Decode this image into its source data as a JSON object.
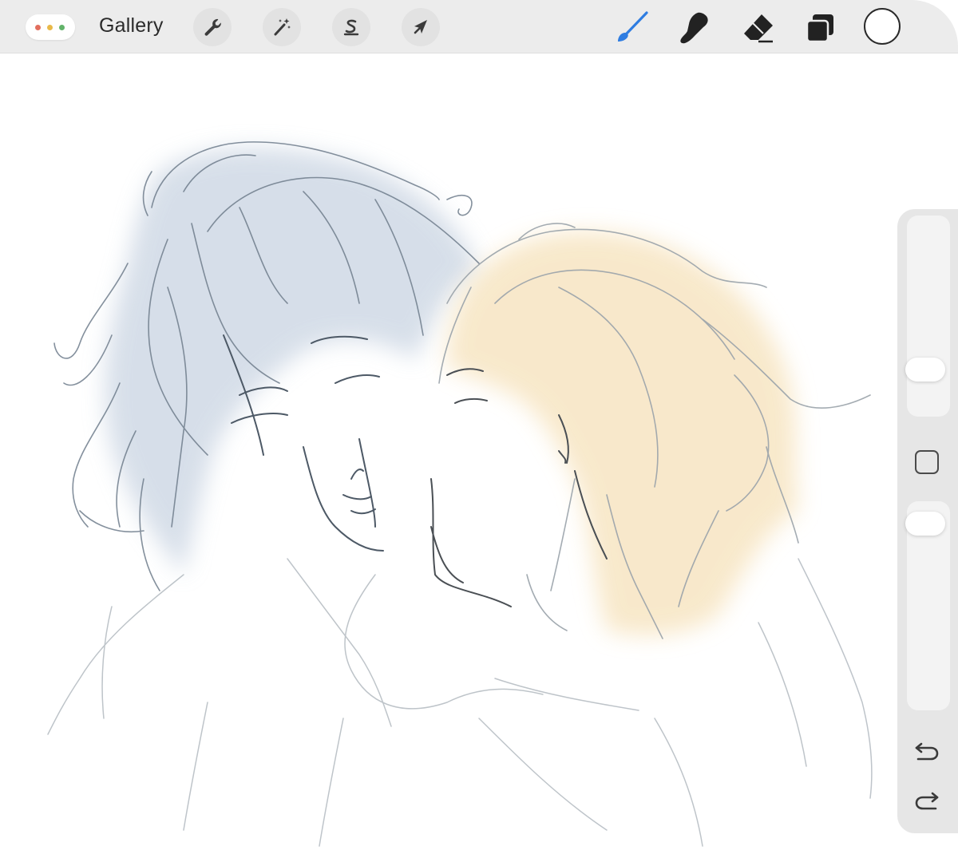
{
  "toolbar": {
    "gallery_label": "Gallery",
    "dots_colors": [
      "#e26f5e",
      "#e9b949",
      "#62b36a"
    ],
    "left_tools": [
      "wrench-icon",
      "magic-wand-icon",
      "selection-icon",
      "transform-arrow-icon"
    ],
    "right_tools": [
      "brush-icon",
      "smudge-icon",
      "eraser-icon",
      "layers-icon"
    ],
    "active_tool": "brush",
    "accent_color": "#2f7de1",
    "current_color": "#ffffff"
  },
  "sidebar": {
    "brush_size_level": 0.18,
    "opacity_level": 0.97,
    "controls": [
      "brush-size-slider",
      "modify-button",
      "opacity-slider",
      "undo-icon",
      "redo-icon"
    ]
  },
  "canvas": {
    "left_hair_color": "#c9d4e2",
    "right_hair_color": "#f7e5c2",
    "line_color": "#7d8791"
  }
}
